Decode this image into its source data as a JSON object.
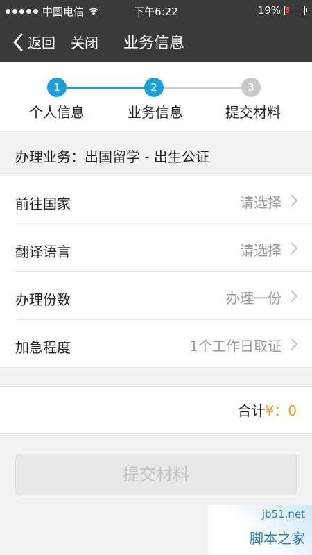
{
  "status_bar": {
    "carrier": "中国电信",
    "time": "下午6:22",
    "battery": "19%",
    "battery_level": 0.19,
    "wifi_icon": "wifi-icon",
    "battery_color": "#e53935"
  },
  "nav": {
    "back_label": "返回",
    "close_label": "关闭",
    "title": "业务信息",
    "back_icon": "chevron-left-icon"
  },
  "steps": [
    {
      "number": "1",
      "label": "个人信息",
      "state": "done"
    },
    {
      "number": "2",
      "label": "业务信息",
      "state": "active"
    },
    {
      "number": "3",
      "label": "提交材料",
      "state": "todo"
    }
  ],
  "service": {
    "label": "办理业务：",
    "value": "出国留学 - 出生公证"
  },
  "form_rows": [
    {
      "label": "前往国家",
      "value": "请选择"
    },
    {
      "label": "翻译语言",
      "value": "请选择"
    },
    {
      "label": "办理份数",
      "value": "办理一份"
    },
    {
      "label": "加急程度",
      "value": "1个工作日取证"
    }
  ],
  "total": {
    "label": "合计",
    "currency": "¥：",
    "amount": "0"
  },
  "submit_label": "提交材料",
  "watermark": {
    "domain": "jb51.net",
    "name": "脚本之家"
  },
  "colors": {
    "accent": "#1a9fdb",
    "nav_bg": "#3a3a3a",
    "price": "#e8a020"
  }
}
